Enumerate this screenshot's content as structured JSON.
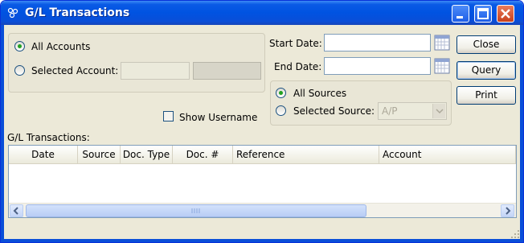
{
  "window": {
    "title": "G/L Transactions",
    "controls": {
      "minimize": "minimize-icon",
      "maximize": "maximize-icon",
      "close": "close-icon"
    }
  },
  "accounts": {
    "all_label": "All Accounts",
    "selected_label": "Selected Account:",
    "selected": "all"
  },
  "dates": {
    "start_label": "Start Date:",
    "end_label": "End Date:",
    "start_value": "",
    "end_value": ""
  },
  "sources": {
    "all_label": "All Sources",
    "selected_label": "Selected Source:",
    "source_value": "A/P",
    "selected": "all"
  },
  "options": {
    "show_username_label": "Show Username",
    "show_username_checked": false
  },
  "buttons": {
    "close": "Close",
    "query": "Query",
    "print": "Print"
  },
  "table": {
    "caption": "G/L Transactions:",
    "columns": [
      "Date",
      "Source",
      "Doc. Type",
      "Doc. #",
      "Reference",
      "Account"
    ],
    "rows": []
  },
  "colors": {
    "titlebar": "#0053e1",
    "accent_radio": "#21a121",
    "window_bg": "#ece9d8"
  }
}
